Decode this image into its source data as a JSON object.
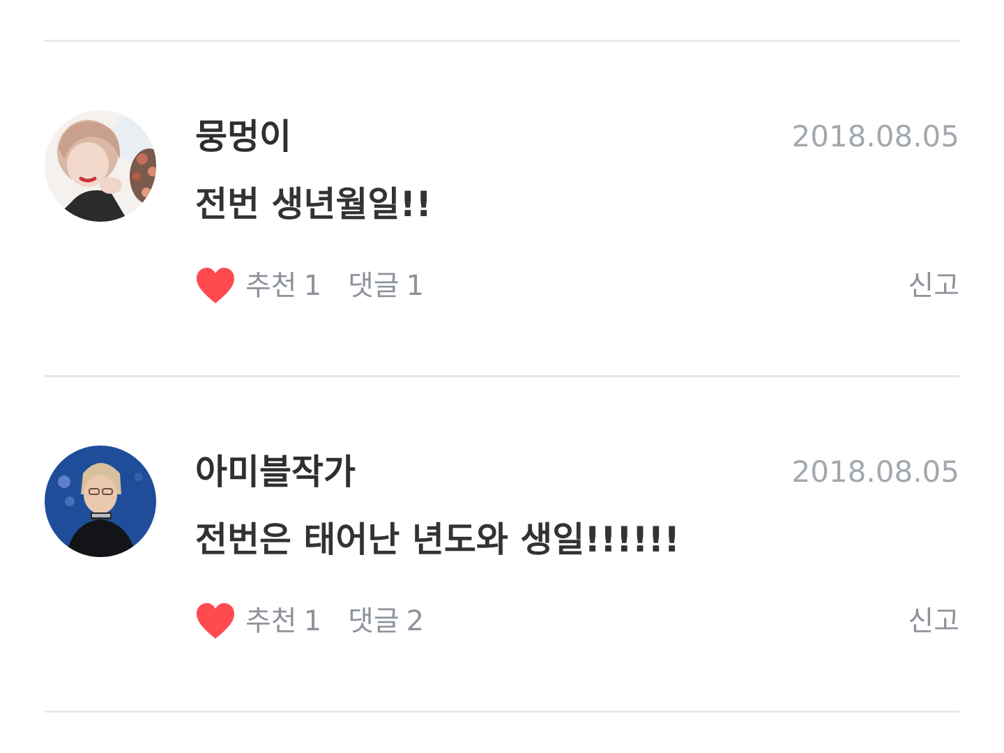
{
  "colors": {
    "heart": "#ff4a4f",
    "divider": "#e7e7e7",
    "muted_text": "#8d939b",
    "date_text": "#a2a8b0"
  },
  "comments": [
    {
      "username": "뭉멍이",
      "date": "2018.08.05",
      "text": "전번 생년월일!!",
      "like_icon": "heart-icon",
      "likes_label": "추천",
      "likes": "1",
      "replies_label": "댓글",
      "replies": "1",
      "report_label": "신고"
    },
    {
      "username": "아미블작가",
      "date": "2018.08.05",
      "text": "전번은 태어난 년도와 생일!!!!!!",
      "like_icon": "heart-icon",
      "likes_label": "추천",
      "likes": "1",
      "replies_label": "댓글",
      "replies": "2",
      "report_label": "신고"
    }
  ]
}
